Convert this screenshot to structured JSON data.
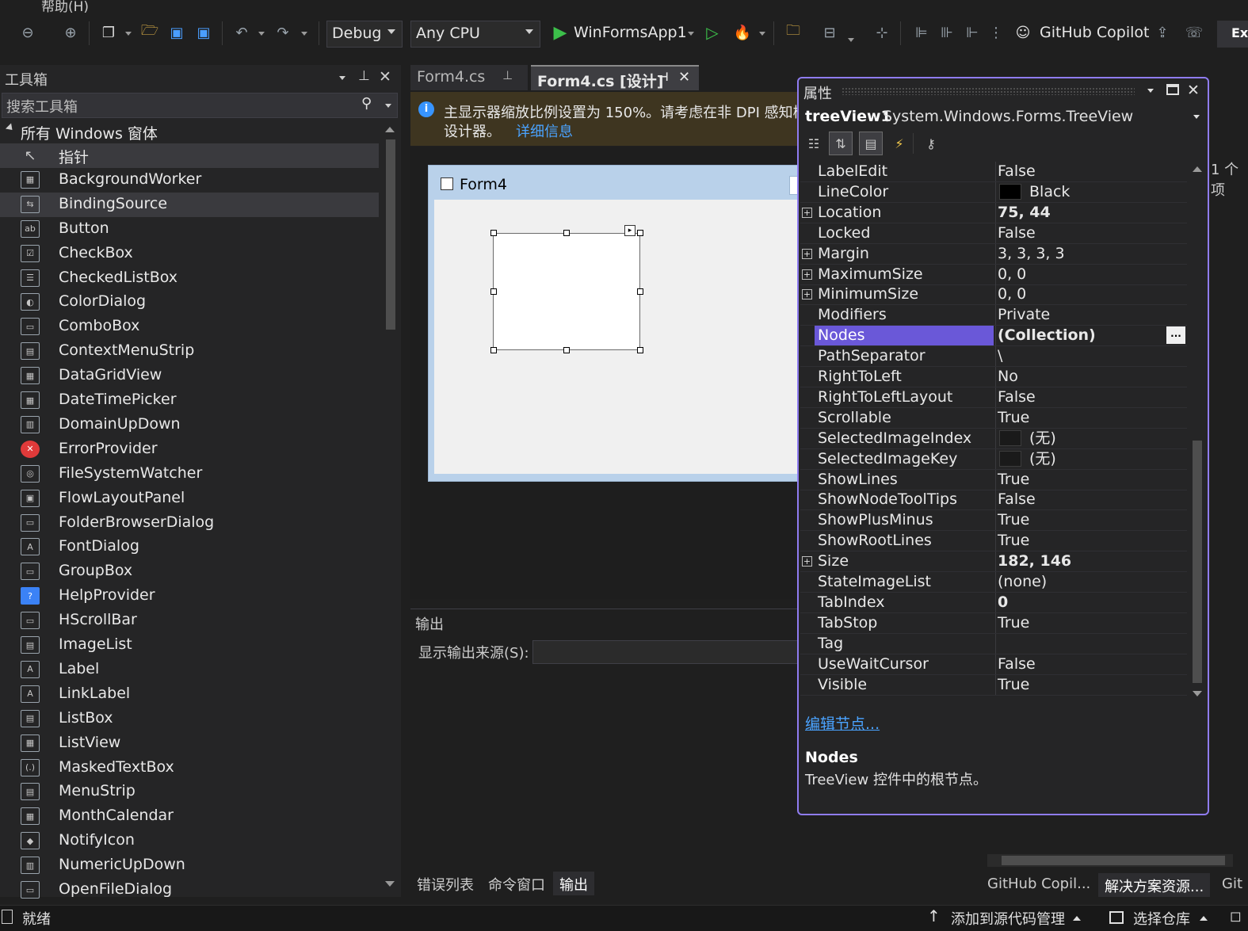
{
  "menu": {
    "help": "帮助(H)"
  },
  "toolbar": {
    "config": "Debug",
    "platform": "Any CPU",
    "startup_project": "WinFormsApp1",
    "copilot": "GitHub Copilot",
    "ext_partial": "Ex"
  },
  "toolbox": {
    "title": "工具箱",
    "search_placeholder": "搜索工具箱",
    "group": "所有 Windows 窗体",
    "items": [
      "指针",
      "BackgroundWorker",
      "BindingSource",
      "Button",
      "CheckBox",
      "CheckedListBox",
      "ColorDialog",
      "ComboBox",
      "ContextMenuStrip",
      "DataGridView",
      "DateTimePicker",
      "DomainUpDown",
      "ErrorProvider",
      "FileSystemWatcher",
      "FlowLayoutPanel",
      "FolderBrowserDialog",
      "FontDialog",
      "GroupBox",
      "HelpProvider",
      "HScrollBar",
      "ImageList",
      "Label",
      "LinkLabel",
      "ListBox",
      "ListView",
      "MaskedTextBox",
      "MenuStrip",
      "MonthCalendar",
      "NotifyIcon",
      "NumericUpDown",
      "OpenFileDialog"
    ],
    "selected_items": [
      "指针",
      "BindingSource"
    ]
  },
  "tabs": {
    "form_cs": "Form4.cs",
    "form_design": "Form4.cs [设计]"
  },
  "infobar": {
    "line1": "主显示器缩放比例设置为 150%。请考虑在非 DPI 感知模",
    "line2": "设计器。",
    "link": "详细信息"
  },
  "designer": {
    "form_title": "Form4"
  },
  "output": {
    "title": "输出",
    "source_label": "显示输出来源(S):",
    "source_value": "",
    "tabs": [
      "错误列表",
      "命令窗口",
      "输出"
    ]
  },
  "right_panel": {
    "partial_text": "1 个项",
    "tabs": [
      "GitHub Copil...",
      "解决方案资源...",
      "Git"
    ]
  },
  "properties": {
    "title": "属性",
    "object_name": "treeView1",
    "object_type": "System.Windows.Forms.TreeView",
    "rows": [
      {
        "name": "LabelEdit",
        "value": "False"
      },
      {
        "name": "LineColor",
        "value": "Black",
        "swatch": "#000000"
      },
      {
        "name": "Location",
        "value": "75, 44",
        "expandable": true,
        "bold": true
      },
      {
        "name": "Locked",
        "value": "False"
      },
      {
        "name": "Margin",
        "value": "3, 3, 3, 3",
        "expandable": true
      },
      {
        "name": "MaximumSize",
        "value": "0, 0",
        "expandable": true
      },
      {
        "name": "MinimumSize",
        "value": "0, 0",
        "expandable": true
      },
      {
        "name": "Modifiers",
        "value": "Private"
      },
      {
        "name": "Nodes",
        "value": "(Collection)",
        "bold": true,
        "selected": true
      },
      {
        "name": "PathSeparator",
        "value": "\\"
      },
      {
        "name": "RightToLeft",
        "value": "No"
      },
      {
        "name": "RightToLeftLayout",
        "value": "False"
      },
      {
        "name": "Scrollable",
        "value": "True"
      },
      {
        "name": "SelectedImageIndex",
        "value": "(无)",
        "swatch": "#1a1a1a"
      },
      {
        "name": "SelectedImageKey",
        "value": "(无)",
        "swatch": "#1a1a1a"
      },
      {
        "name": "ShowLines",
        "value": "True"
      },
      {
        "name": "ShowNodeToolTips",
        "value": "False"
      },
      {
        "name": "ShowPlusMinus",
        "value": "True"
      },
      {
        "name": "ShowRootLines",
        "value": "True"
      },
      {
        "name": "Size",
        "value": "182, 146",
        "expandable": true,
        "bold": true
      },
      {
        "name": "StateImageList",
        "value": "(none)"
      },
      {
        "name": "TabIndex",
        "value": "0",
        "bold": true
      },
      {
        "name": "TabStop",
        "value": "True"
      },
      {
        "name": "Tag",
        "value": ""
      },
      {
        "name": "UseWaitCursor",
        "value": "False"
      },
      {
        "name": "Visible",
        "value": "True"
      }
    ],
    "ellipsis": "...",
    "edit_link": "编辑节点...",
    "desc_title": "Nodes",
    "desc_text": "TreeView 控件中的根节点。"
  },
  "status": {
    "ready": "就绪",
    "source_control": "添加到源代码管理",
    "repo": "选择仓库"
  },
  "colors": {
    "accent": "#8f7cf0",
    "selection": "#6a58d8",
    "link": "#4aa3ff",
    "run_green": "#3cbf4a"
  }
}
